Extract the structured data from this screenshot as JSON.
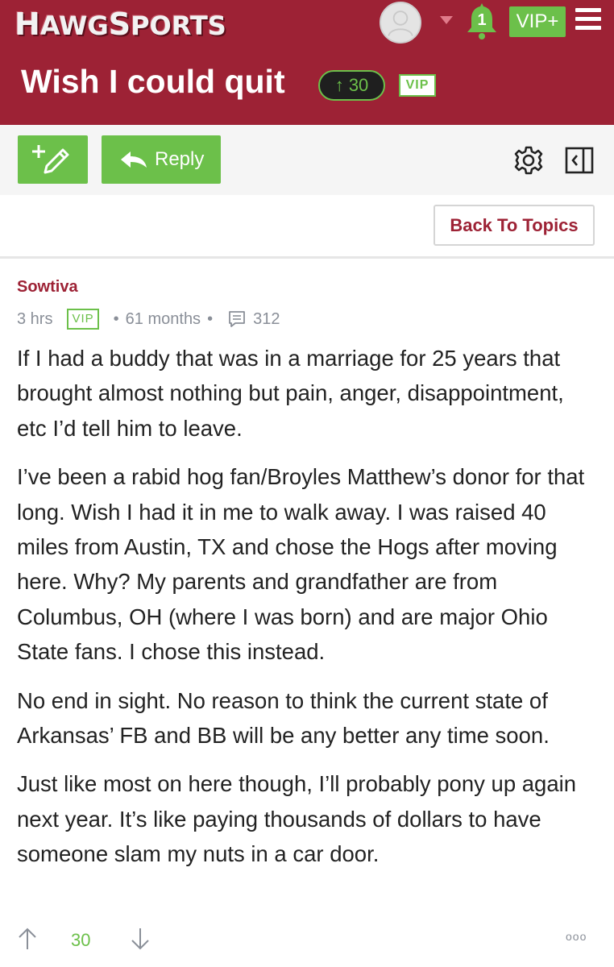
{
  "brand": {
    "logo_text": "HawgSports",
    "accent": "#9d2235",
    "green": "#6cc04a"
  },
  "header": {
    "notification_count": "1",
    "vip_plus_label": "VIP+",
    "thread_title": "Wish I could quit",
    "thread_score": "30",
    "thread_vip_label": "VIP"
  },
  "toolbar": {
    "reply_label": "Reply",
    "new_icon": "new-post-icon",
    "settings_icon": "gear-icon",
    "panel_icon": "panel-collapse-icon"
  },
  "back_to_topics_label": "Back To Topics",
  "post": {
    "author": "Sowtiva",
    "time_ago": "3 hrs",
    "vip_label": "VIP",
    "tenure": "61 months",
    "post_count": "312",
    "paragraphs": [
      "If I had a buddy that was in a marriage for 25 years that brought almost nothing but pain, anger, disappointment, etc I’d tell him to leave.",
      "I’ve been a rabid hog fan/Broyles Matthew’s donor for that long. Wish I had it in me to walk away. I was raised 40 miles from Austin, TX and chose the Hogs after moving here. Why? My parents and grandfather are from Columbus, OH (where I was born) and are major Ohio State fans. I chose this instead.",
      "No end in sight. No reason to think the current state of Arkansas’ FB and BB will be any better any time soon.",
      "Just like most on here though, I’ll probably pony up again next year. It’s like paying thousands of dollars to have someone slam my nuts in a car door."
    ],
    "score": "30",
    "more_label": "ooo"
  }
}
